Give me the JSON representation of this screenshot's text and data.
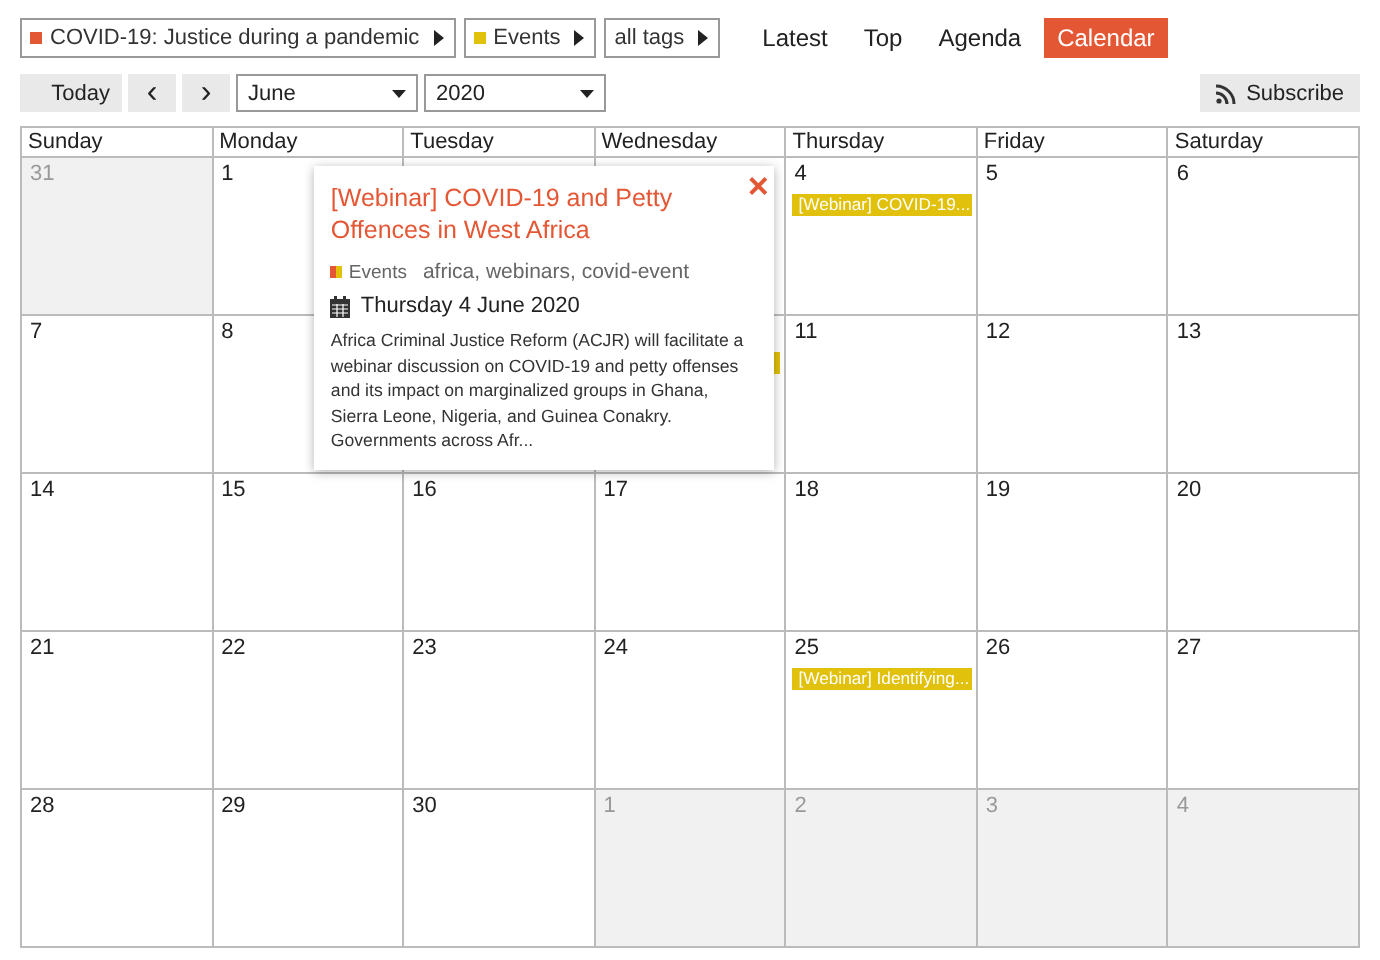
{
  "filters": [
    {
      "label": "COVID-19: Justice during a pandemic",
      "color": "#e45735"
    },
    {
      "label": "Events",
      "color": "#e1c10b"
    },
    {
      "label": "all tags"
    }
  ],
  "nav": [
    {
      "label": "Latest",
      "selected": false
    },
    {
      "label": "Top",
      "selected": false
    },
    {
      "label": "Agenda",
      "selected": false
    },
    {
      "label": "Calendar",
      "selected": true
    }
  ],
  "toolbar": {
    "today": "Today",
    "prev": "‹",
    "next": "›",
    "month": "June",
    "year": "2020",
    "subscribe": "Subscribe"
  },
  "weekdays": [
    "Sunday",
    "Monday",
    "Tuesday",
    "Wednesday",
    "Thursday",
    "Friday",
    "Saturday"
  ],
  "weeks": [
    [
      {
        "day": "31",
        "other_month": true
      },
      {
        "day": "1",
        "other_month": false
      },
      {
        "other_month": false
      },
      {
        "other_month": false
      },
      {
        "day": "4",
        "other_month": false,
        "events": [
          {
            "title": "[Webinar] COVID-19...",
            "color": "#e1c10b"
          }
        ]
      },
      {
        "day": "5",
        "other_month": false
      },
      {
        "day": "6",
        "other_month": false
      }
    ],
    [
      {
        "day": "7",
        "other_month": false
      },
      {
        "day": "8",
        "other_month": false
      },
      {
        "under_popup": true
      },
      {
        "events": [
          {
            "color": "#e1c10b"
          }
        ]
      },
      {
        "day": "11",
        "other_month": false
      },
      {
        "day": "12",
        "other_month": false
      },
      {
        "day": "13",
        "other_month": false
      }
    ],
    [
      {
        "day": "14",
        "other_month": false
      },
      {
        "day": "15",
        "other_month": false
      },
      {
        "day": "16",
        "other_month": false
      },
      {
        "day": "17",
        "other_month": false
      },
      {
        "day": "18",
        "other_month": false
      },
      {
        "day": "19",
        "other_month": false
      },
      {
        "day": "20",
        "other_month": false
      }
    ],
    [
      {
        "day": "21",
        "other_month": false
      },
      {
        "day": "22",
        "other_month": false
      },
      {
        "day": "23",
        "other_month": false
      },
      {
        "day": "24",
        "other_month": false
      },
      {
        "day": "25",
        "other_month": false,
        "events": [
          {
            "title": "[Webinar] Identifying...",
            "color": "#e1c10b"
          }
        ]
      },
      {
        "day": "26",
        "other_month": false
      },
      {
        "day": "27",
        "other_month": false
      }
    ],
    [
      {
        "day": "28",
        "other_month": false
      },
      {
        "day": "29",
        "other_month": false
      },
      {
        "day": "30",
        "other_month": false
      },
      {
        "day": "1",
        "other_month": true
      },
      {
        "day": "2",
        "other_month": true
      },
      {
        "day": "3",
        "other_month": true
      },
      {
        "day": "4",
        "other_month": true
      }
    ]
  ],
  "popup": {
    "title": "[Webinar] COVID-19 and Petty Offences in West Africa",
    "close": "×",
    "category": "Events",
    "tags": "africa, webinars, covid-event",
    "date": "Thursday 4 June 2020",
    "excerpt": "Africa Criminal Justice Reform (ACJR) will facilitate a webinar discussion on COVID-19 and petty offenses and its impact on marginalized groups in Ghana, Sierra Leone, Nigeria, and Guinea Conakry. Governments across Afr..."
  }
}
